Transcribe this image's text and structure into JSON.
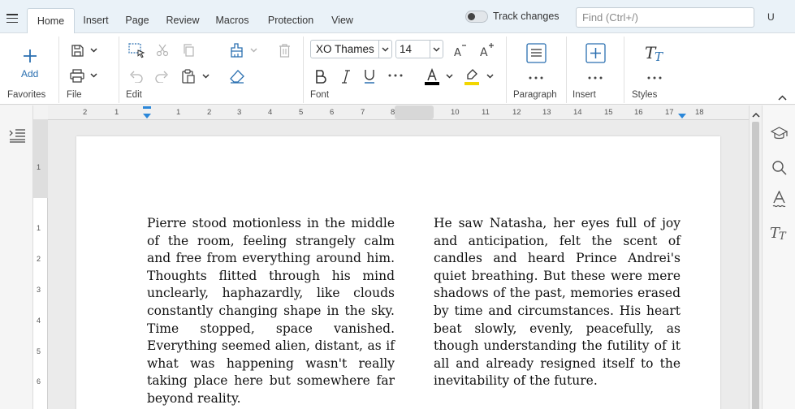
{
  "tabs": [
    "Home",
    "Insert",
    "Page",
    "Review",
    "Macros",
    "Protection",
    "View"
  ],
  "track_changes": {
    "label": "Track changes",
    "enabled": false
  },
  "search": {
    "placeholder": "Find (Ctrl+/)"
  },
  "user_initial": "U",
  "ribbon": {
    "add_label": "Add",
    "groups": [
      "Favorites",
      "File",
      "Edit",
      "Font",
      "Paragraph",
      "Insert",
      "Styles"
    ],
    "font_family": "XO Thames",
    "font_size": "14",
    "colors": {
      "font_color": "#000000",
      "highlight": "#f2d600",
      "accent": "#2a6fb0"
    }
  },
  "ruler": {
    "h_numbers": [
      "2",
      "1",
      "1",
      "2",
      "3",
      "4",
      "5",
      "6",
      "7",
      "8",
      "10",
      "11",
      "12",
      "13",
      "14",
      "15",
      "16",
      "17",
      "18"
    ],
    "v_numbers": [
      "1",
      "1",
      "2",
      "3",
      "4",
      "5",
      "6"
    ]
  },
  "document": {
    "left_column": "Pierre stood motionless in the middle of the room, feeling strangely calm and free from everything around him. Thoughts flitted through his mind unclearly, haphazardly, like clouds constantly changing shape in the sky. Time stopped, space vanished. Everything seemed alien, distant, as if what was happening wasn't really taking place here but somewhere far beyond reality.",
    "right_column": "He saw Natasha, her eyes full of joy and anticipation, felt the scent of candles and heard Prince Andrei's quiet breathing. But these were mere shadows of the past, memories erased by time and circumstances. His heart beat slowly, evenly, peacefully, as though understanding the futility of it all and already resigned itself to the inevitability of the future."
  }
}
